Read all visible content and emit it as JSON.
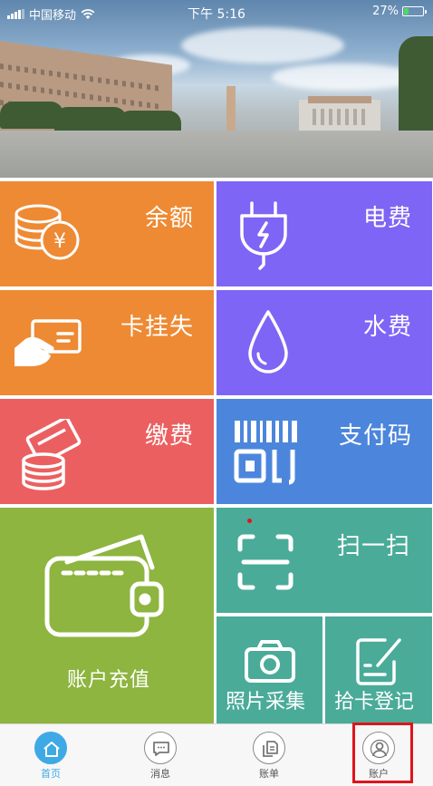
{
  "status_bar": {
    "carrier": "中国移动",
    "time": "下午 5:16",
    "battery_percent": "27%",
    "battery_level": 0.27
  },
  "tiles": {
    "balance": {
      "label": "余额",
      "color": "#ee8a33",
      "icon": "coins-yen-icon"
    },
    "electricity": {
      "label": "电费",
      "color": "#7e65f5",
      "icon": "plug-icon"
    },
    "report_lost": {
      "label": "卡挂失",
      "color": "#ee8a33",
      "icon": "hand-card-icon"
    },
    "water": {
      "label": "水费",
      "color": "#7e65f5",
      "icon": "water-drop-icon"
    },
    "pay_fees": {
      "label": "缴费",
      "color": "#ec5f60",
      "icon": "card-coins-icon"
    },
    "pay_code": {
      "label": "支付码",
      "color": "#4c86dc",
      "icon": "barcode-qr-icon"
    },
    "recharge": {
      "label": "账户充值",
      "color": "#8db53f",
      "icon": "wallet-icon"
    },
    "scan": {
      "label": "扫一扫",
      "color": "#4aab99",
      "icon": "scan-frame-icon"
    },
    "photo": {
      "label": "照片采集",
      "color": "#4aab99",
      "icon": "camera-icon"
    },
    "found_card": {
      "label": "拾卡登记",
      "color": "#4aab99",
      "icon": "edit-note-icon"
    }
  },
  "tab_bar": {
    "items": [
      {
        "label": "首页",
        "icon": "home-icon",
        "active": true
      },
      {
        "label": "消息",
        "icon": "message-icon",
        "active": false
      },
      {
        "label": "账单",
        "icon": "bill-icon",
        "active": false
      },
      {
        "label": "账户",
        "icon": "user-icon",
        "active": false
      }
    ],
    "accent": "#3fa9e6",
    "highlight_color": "#e1141b"
  }
}
